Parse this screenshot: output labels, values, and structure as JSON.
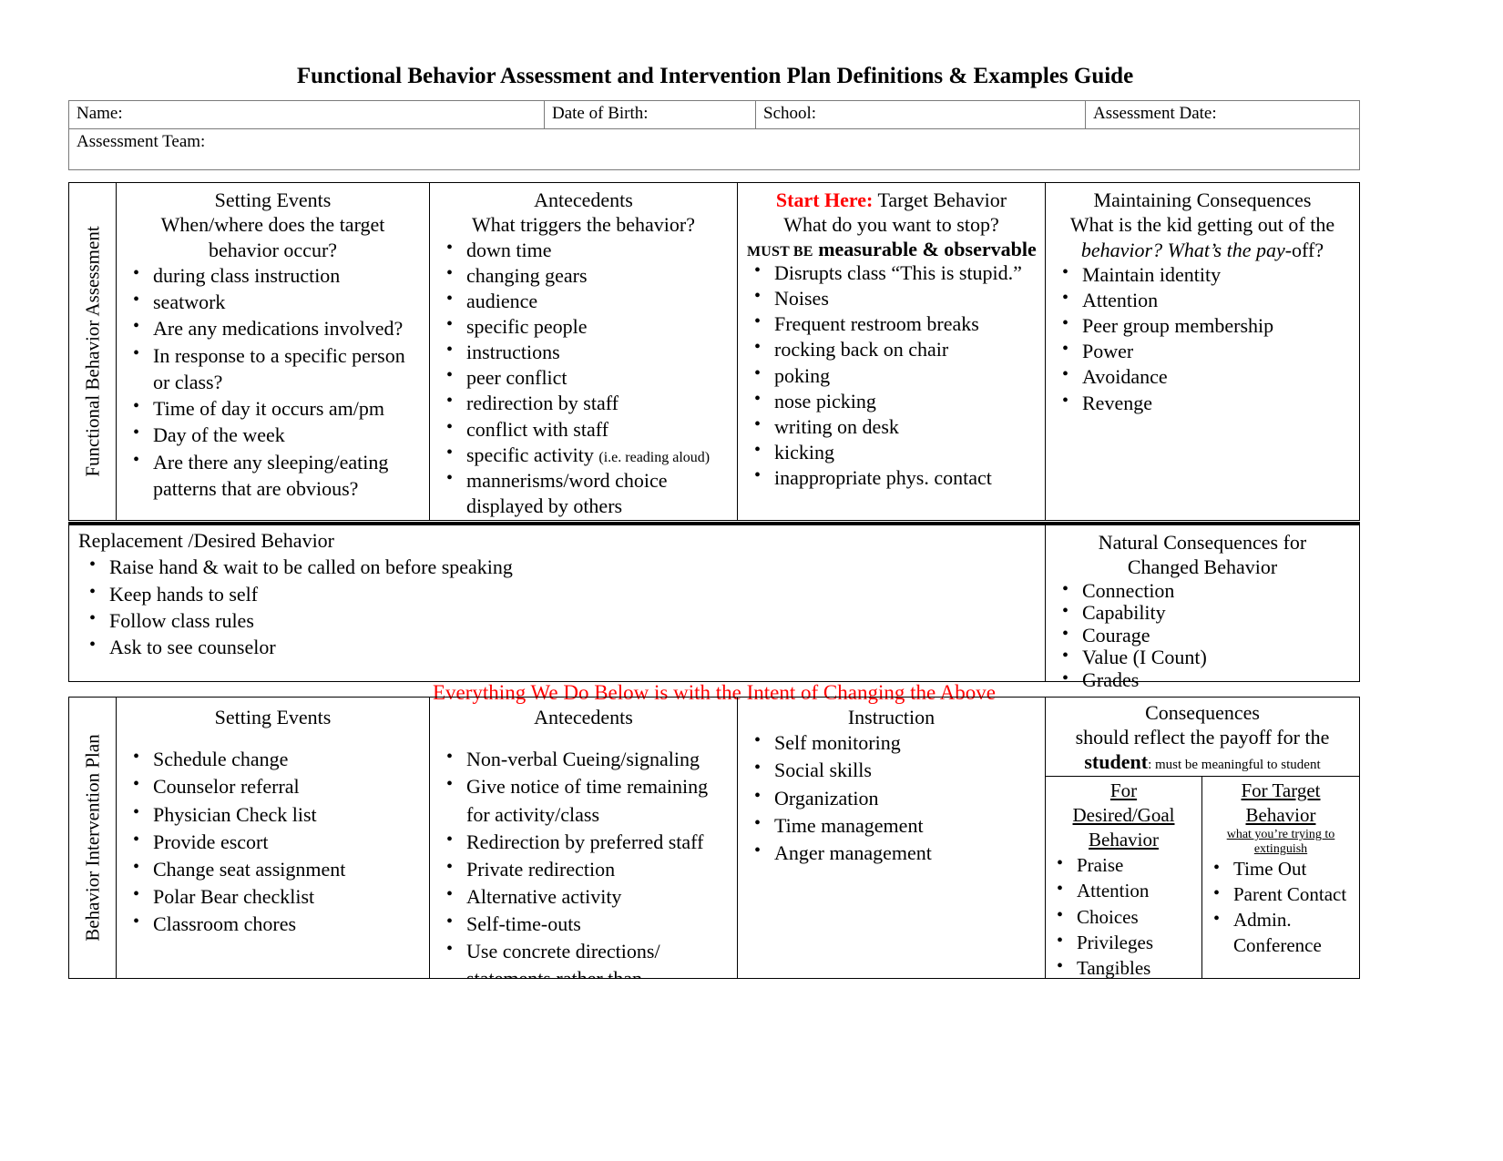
{
  "document": {
    "title": "Functional Behavior Assessment and Intervention Plan Definitions & Examples Guide"
  },
  "identity": {
    "name_label": "Name:",
    "dob_label": "Date of Birth:",
    "school_label": "School:",
    "assessment_date_label": "Assessment Date:",
    "team_label": "Assessment Team:"
  },
  "fba": {
    "section_label": "Functional Behavior Assessment",
    "setting_events": {
      "title": "Setting Events",
      "subtitle_line1": "When/where does the target",
      "subtitle_line2": "behavior occur?",
      "items": [
        "during class instruction",
        "seatwork",
        "Are any medications involved?",
        "In response to a specific person or class?",
        "Time of day it occurs am/pm",
        "Day of the week",
        "Are there any sleeping/eating patterns that are obvious?"
      ]
    },
    "antecedents": {
      "title": "Antecedents",
      "subtitle": "What triggers the behavior?",
      "items": [
        "down time",
        "changing gears",
        "audience",
        "specific people",
        "instructions",
        "peer conflict",
        "redirection by staff",
        "conflict with staff"
      ],
      "item_specific_activity": "specific activity",
      "item_specific_activity_note": "(i.e. reading aloud)",
      "item_mannerisms": "mannerisms/word choice displayed by others"
    },
    "target_behavior": {
      "start_here": "Start Here:",
      "title_rest": " Target Behavior",
      "subtitle": "What do you want to stop?",
      "must_be_small": "MUST BE",
      "must_be_bold": "measurable & observable",
      "items": [
        "Disrupts class “This is stupid.”",
        "Noises",
        "Frequent restroom breaks",
        "rocking back on chair",
        "poking",
        "nose picking",
        "writing on desk",
        "kicking",
        "inappropriate phys. contact"
      ]
    },
    "maintaining_consequences": {
      "title": "Maintaining Consequences",
      "subtitle_line1": "What is the kid getting out of the",
      "subtitle_line2_italic": "behavior? What’s the pay",
      "subtitle_line2_rest": "-off?",
      "items": [
        "Maintain identity",
        "Attention",
        "Peer group membership",
        "Power",
        "Avoidance",
        "Revenge"
      ]
    }
  },
  "replacement": {
    "title": "Replacement /Desired Behavior",
    "items": [
      "Raise hand & wait to be called on before speaking",
      "Keep hands to self",
      "Follow class rules",
      "Ask to see counselor"
    ],
    "natural_consequences": {
      "title_line1": "Natural Consequences for",
      "title_line2": "Changed Behavior",
      "items": [
        "Connection",
        "Capability",
        "Courage",
        "Value (I Count)",
        "Grades"
      ]
    }
  },
  "red_banner": "Everything We Do Below is with the Intent of Changing the Above",
  "bip": {
    "section_label": "Behavior Intervention Plan",
    "setting_events": {
      "title": "Setting Events",
      "items": [
        "Schedule change",
        "Counselor referral",
        "Physician Check list",
        "Provide escort",
        "Change seat assignment",
        "Polar Bear checklist",
        "Classroom chores"
      ]
    },
    "antecedents": {
      "title": "Antecedents",
      "items": [
        "Non-verbal Cueing/signaling",
        "Give notice of time remaining for activity/class",
        "Redirection by preferred staff",
        "Private redirection",
        "Alternative activity",
        "Self-time-outs",
        "Use concrete directions/ statements rather than"
      ]
    },
    "instruction": {
      "title": "Instruction",
      "items": [
        "Self monitoring",
        "Social skills",
        "Organization",
        "Time management",
        "Anger management"
      ]
    },
    "consequences": {
      "title": "Consequences",
      "subtitle_line1": "should reflect the payoff for the",
      "subtitle_student": "student",
      "subtitle_note": ": must be meaningful to student",
      "desired": {
        "title_line1": "For",
        "title_line2": "Desired/Goal",
        "title_line3": "Behavior",
        "items": [
          "Praise",
          "Attention",
          "Choices",
          "Privileges",
          "Tangibles"
        ]
      },
      "target": {
        "title_line1": "For Target",
        "title_line2": "Behavior",
        "note_line1": "what you’re trying to",
        "note_line2": "extinguish",
        "items": [
          "Time Out",
          "Parent Contact",
          "Admin. Conference"
        ]
      }
    }
  },
  "colors": {
    "red": "#ff0000",
    "border": "#000000",
    "ident_border": "#7a7a7a"
  }
}
